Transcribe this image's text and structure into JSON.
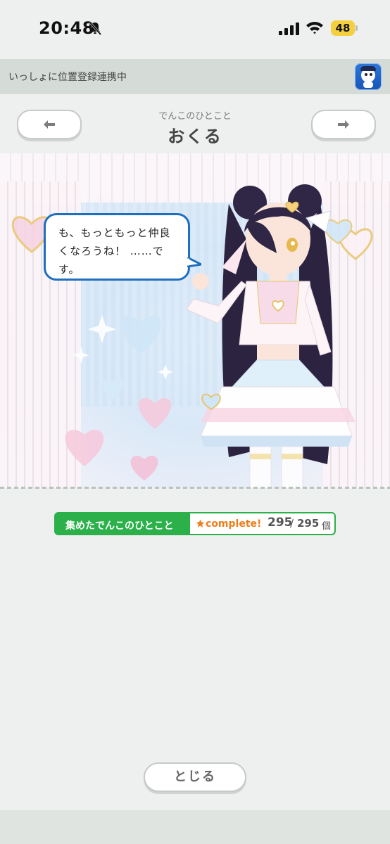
{
  "status_bar": {
    "time": "20:48",
    "battery": "48"
  },
  "notice": {
    "text": "いっしょに位置登録連携中"
  },
  "header": {
    "subtitle": "でんこのひとこと",
    "title": "おくる",
    "prev_icon": "left-arrow-icon",
    "next_icon": "right-arrow-icon"
  },
  "scene": {
    "speech_line1": "も、もっともっと仲良",
    "speech_line2": "くなろうね！ ……で",
    "speech_line3": "す。"
  },
  "collection": {
    "label": "集めたでんこのひとこと",
    "complete": "complete!",
    "current": "295",
    "separator": "/",
    "total": "295",
    "unit": "個"
  },
  "footer": {
    "close_label": "とじる"
  },
  "colors": {
    "accent_green": "#2bb04a",
    "bubble_border": "#1f6fbf",
    "complete_orange": "#f07d18"
  }
}
